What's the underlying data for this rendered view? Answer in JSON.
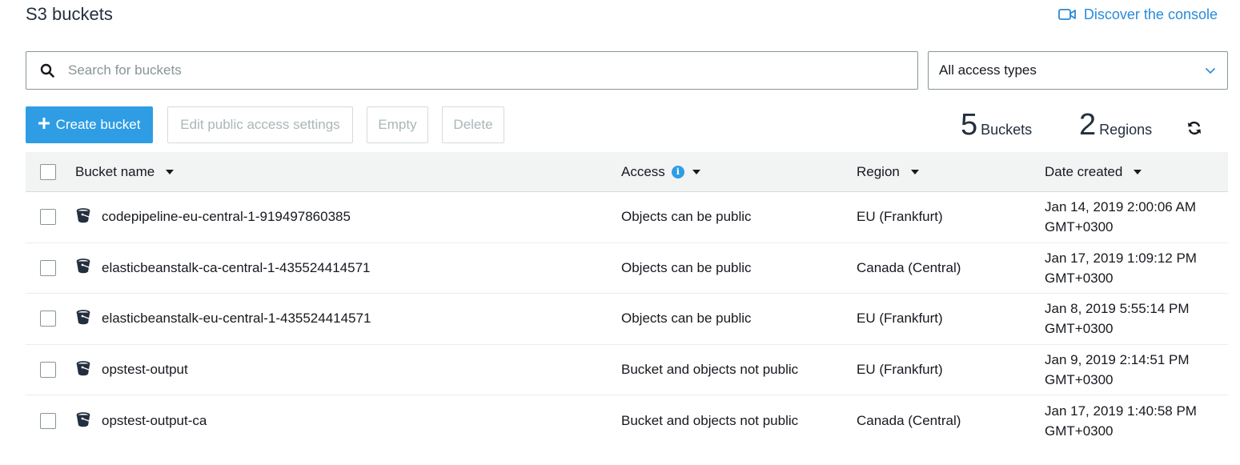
{
  "header": {
    "title": "S3 buckets",
    "discover_label": "Discover the console",
    "discover_icon": "video-camera-icon"
  },
  "search": {
    "placeholder": "Search for buckets",
    "value": ""
  },
  "filter": {
    "selected": "All access types"
  },
  "toolbar": {
    "create_label": "Create bucket",
    "edit_label": "Edit public access settings",
    "empty_label": "Empty",
    "delete_label": "Delete"
  },
  "stats": {
    "buckets_count": "5",
    "buckets_label": "Buckets",
    "regions_count": "2",
    "regions_label": "Regions"
  },
  "table": {
    "columns": {
      "name": "Bucket name",
      "access": "Access",
      "region": "Region",
      "date": "Date created"
    },
    "rows": [
      {
        "name": "codepipeline-eu-central-1-919497860385",
        "access": "Objects can be public",
        "region": "EU (Frankfurt)",
        "date": "Jan 14, 2019 2:00:06 AM",
        "tz": "GMT+0300"
      },
      {
        "name": "elasticbeanstalk-ca-central-1-435524414571",
        "access": "Objects can be public",
        "region": "Canada (Central)",
        "date": "Jan 17, 2019 1:09:12 PM",
        "tz": "GMT+0300"
      },
      {
        "name": "elasticbeanstalk-eu-central-1-435524414571",
        "access": "Objects can be public",
        "region": "EU (Frankfurt)",
        "date": "Jan 8, 2019 5:55:14 PM",
        "tz": "GMT+0300"
      },
      {
        "name": "opstest-output",
        "access": "Bucket and objects not public",
        "region": "EU (Frankfurt)",
        "date": "Jan 9, 2019 2:14:51 PM",
        "tz": "GMT+0300"
      },
      {
        "name": "opstest-output-ca",
        "access": "Bucket and objects not public",
        "region": "Canada (Central)",
        "date": "Jan 17, 2019 1:40:58 PM",
        "tz": "GMT+0300"
      }
    ]
  },
  "colors": {
    "primary": "#2e9de4",
    "link": "#2a8bd8",
    "disabled_text": "#aab7b8",
    "header_bg": "#f2f3f3"
  }
}
